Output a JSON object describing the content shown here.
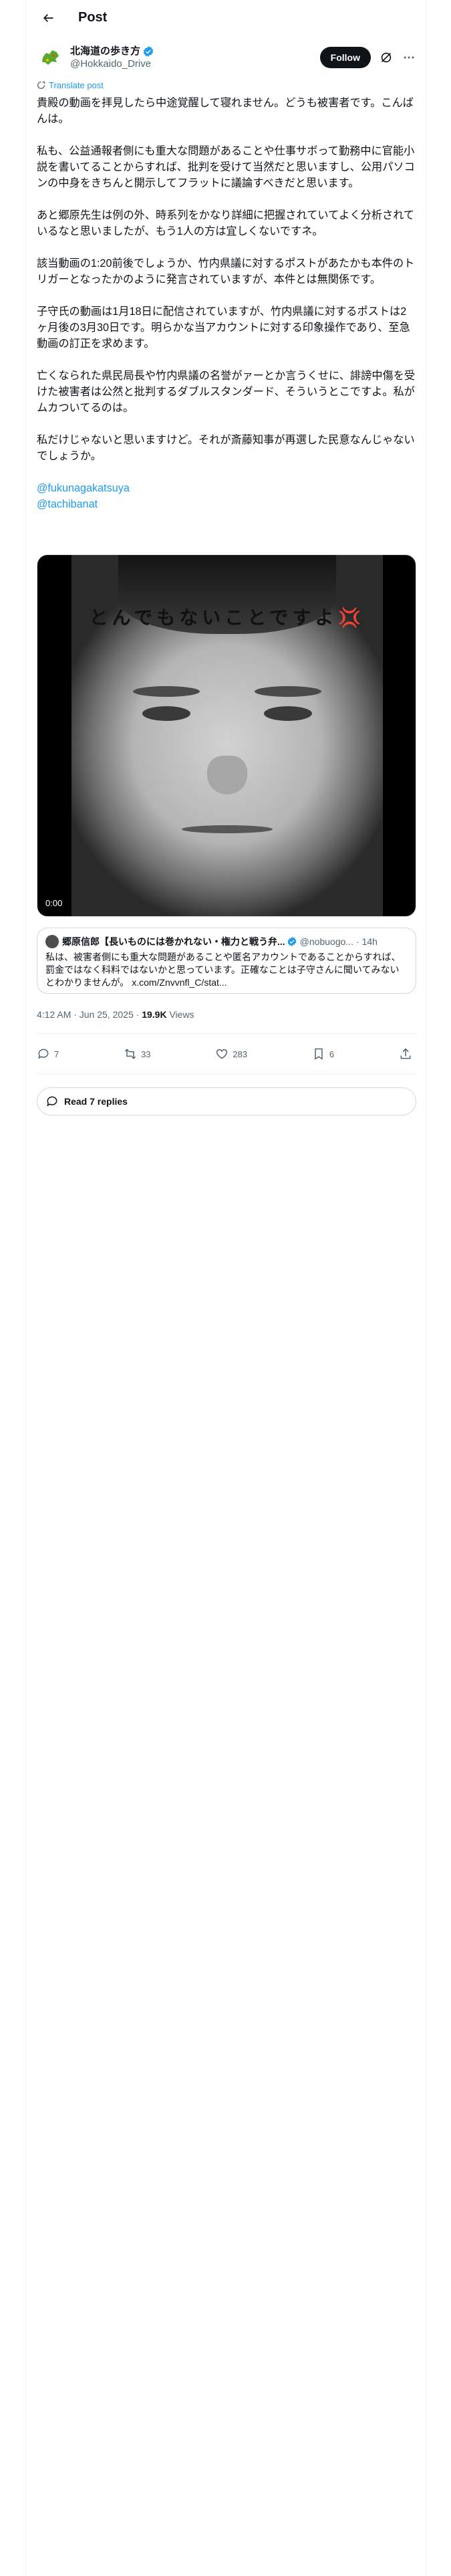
{
  "header": {
    "title": "Post"
  },
  "author": {
    "name": "北海道の歩き方",
    "handle": "@Hokkaido_Drive",
    "follow_label": "Follow"
  },
  "translate_label": "Translate post",
  "post": {
    "paragraphs": [
      "貴殿の動画を拝見したら中途覚醒して寝れません。どうも被害者です。こんばんは。",
      "私も、公益通報者側にも重大な問題があることや仕事サボって勤務中に官能小説を書いてることからすれば、批判を受けて当然だと思いますし、公用パソコンの中身をきちんと開示してフラットに議論すべきだと思います。",
      "あと郷原先生は例の外、時系列をかなり詳細に把握されていてよく分析されているなと思いましたが、もう1人の方は宜しくないですネ。",
      "該当動画の1:20前後でしょうか、竹内県議に対するポストがあたかも本件のトリガーとなったかのように発言されていますが、本件とは無関係です。",
      "子守氏の動画は1月18日に配信されていますが、竹内県議に対するポストは2ヶ月後の3月30日です。明らかな当アカウントに対する印象操作であり、至急動画の訂正を求めます。",
      "亡くなられた県民局長や竹内県議の名誉がァーとか言うくせに、誹謗中傷を受けた被害者は公然と批判するダブルスタンダード、そういうとこですよ。私がムカついてるのは。",
      "私だけじゃないと思いますけど。それが斎藤知事が再選した民意なんじゃないでしょうか。"
    ],
    "mentions": [
      "@fukunagakatsuya",
      "@tachibanat"
    ]
  },
  "media": {
    "caption": "とんでもないことですよ",
    "emoji": "💢",
    "timestamp": "0:00"
  },
  "quote": {
    "name": "郷原信郎【長いものには巻かれない・権力と戦う弁護士】",
    "name_display": "郷原信郎【長いものには巻かれない・権力と戦う弁...",
    "handle": "@nobuogo...",
    "time": "· 14h",
    "text": "私は、被害者側にも重大な問題があることや匿名アカウントであることからすれば、罰金ではなく科料ではないかと思っています。正確なことは子守さんに聞いてみないとわかりませんが。 x.com/Znvvnfl_C/stat..."
  },
  "meta": {
    "time": "4:12 AM · Jun 25, 2025 · ",
    "views_count": "19.9K",
    "views_label": " Views"
  },
  "actions": {
    "replies": "7",
    "reposts": "33",
    "likes": "283",
    "bookmarks": "6"
  },
  "read_replies_label": "Read 7 replies",
  "colors": {
    "accent": "#1d9bf0",
    "text": "#0f1419",
    "muted": "#536471",
    "border": "#cfd9de"
  }
}
